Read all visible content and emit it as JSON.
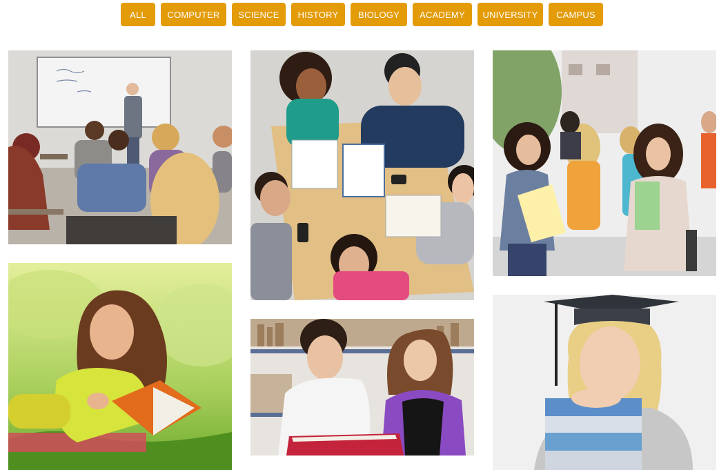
{
  "filters": [
    {
      "label": "ALL"
    },
    {
      "label": "COMPUTER"
    },
    {
      "label": "SCIENCE"
    },
    {
      "label": "HISTORY"
    },
    {
      "label": "BIOLOGY"
    },
    {
      "label": "ACADEMY"
    },
    {
      "label": "UNIVERSITY"
    },
    {
      "label": "CAMPUS"
    }
  ],
  "colors": {
    "accent": "#e39b08",
    "button_text": "#ffffff",
    "background": "#ffffff"
  },
  "gallery": [
    {
      "subject": "classroom-lecture"
    },
    {
      "subject": "student-reading-outdoors"
    },
    {
      "subject": "students-around-table"
    },
    {
      "subject": "students-library-book"
    },
    {
      "subject": "students-walking-campus"
    },
    {
      "subject": "graduate-with-books"
    }
  ]
}
